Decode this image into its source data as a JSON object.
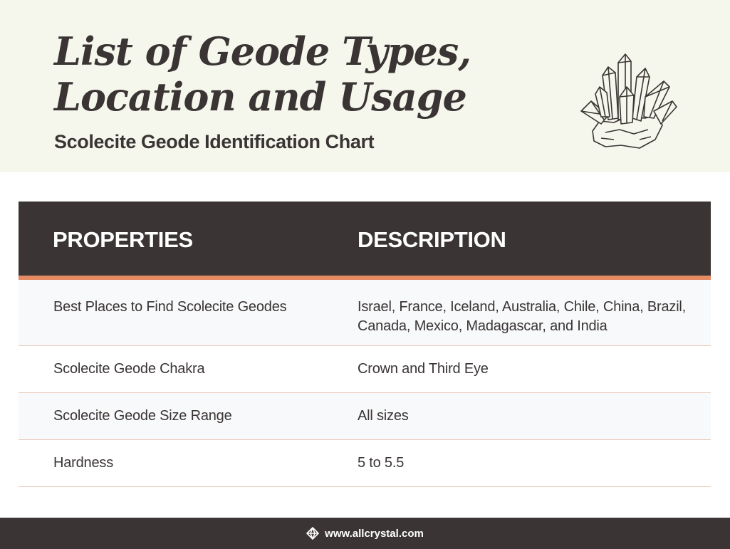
{
  "header": {
    "title": "List of Geode Types, Location and Usage",
    "subtitle": "Scolecite Geode Identification Chart",
    "illustration_icon": "crystal-cluster-icon"
  },
  "table": {
    "columns": [
      "PROPERTIES",
      "DESCRIPTION"
    ],
    "rows": [
      {
        "property": "Best Places to Find Scolecite Geodes",
        "description": "Israel, France, Iceland, Australia, Chile, China, Brazil, Canada, Mexico, Madagascar, and India"
      },
      {
        "property": "Scolecite Geode Chakra",
        "description": "Crown and Third Eye"
      },
      {
        "property": "Scolecite Geode Size Range",
        "description": "All sizes"
      },
      {
        "property": "Hardness",
        "description": "5 to 5.5"
      }
    ]
  },
  "footer": {
    "url": "www.allcrystal.com",
    "icon": "crystal-logo-icon"
  },
  "colors": {
    "header_bg": "#f6f7ec",
    "dark": "#3a3534",
    "accent": "#e58a62",
    "row_alt": "#f8f9fb"
  }
}
